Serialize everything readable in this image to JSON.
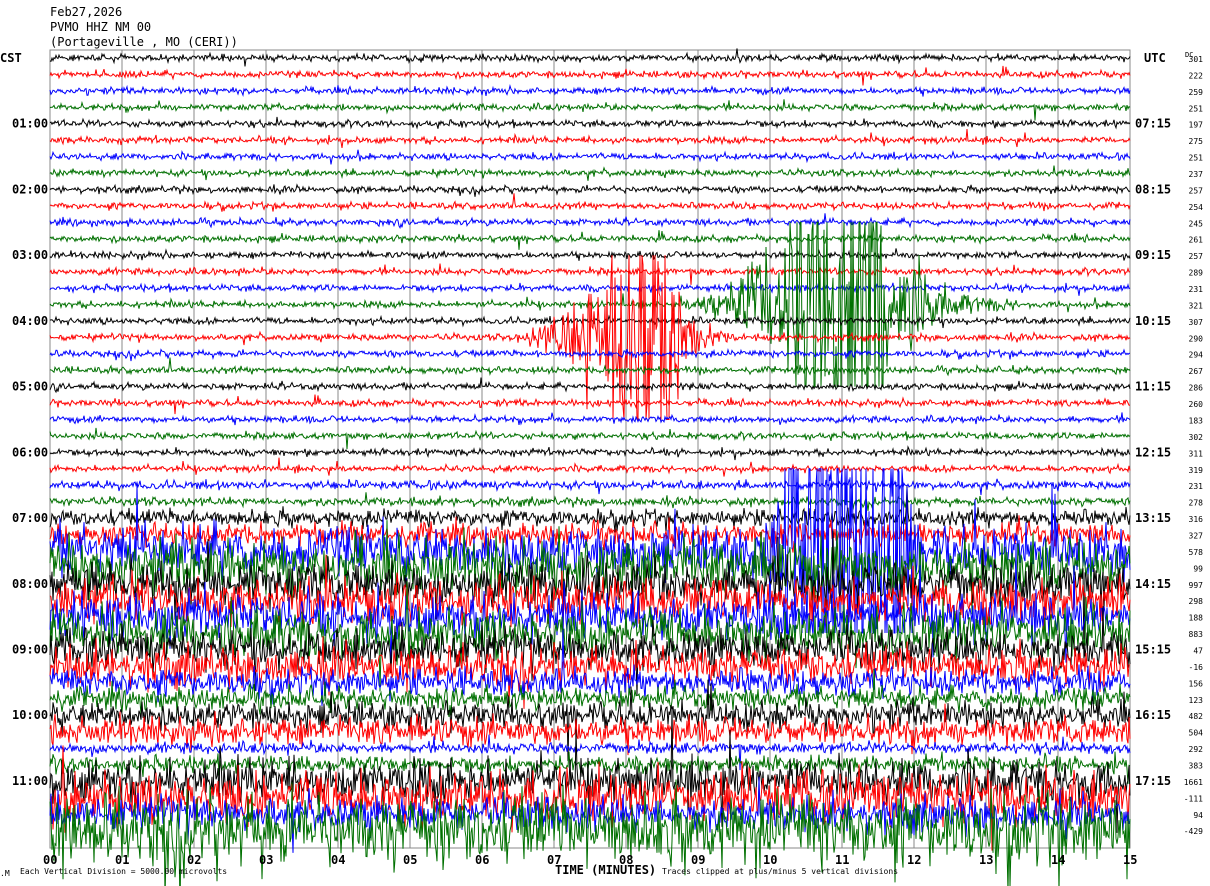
{
  "header": {
    "date": "Feb27,2026",
    "station": "PVMO HHZ NM 00",
    "location": "(Portageville , MO (CERI))",
    "left_tz": "CST",
    "right_tz": "UTC",
    "dc_label": "DC"
  },
  "footer": {
    "scale_note": "Each Vertical Division = 5000.00 microvolts",
    "xlabel": "TIME (MINUTES)",
    "clip_note": "Traces clipped at plus/minus 5 vertical divisions"
  },
  "colors": {
    "cycle": [
      "#000000",
      "#ff0000",
      "#0000ff",
      "#007000"
    ],
    "grid": "#888888"
  },
  "chart_data": {
    "type": "line",
    "title": "PVMO HHZ NM 00 helicorder",
    "xlabel": "TIME (MINUTES)",
    "xlim": [
      0,
      15
    ],
    "x_ticks": [
      "00",
      "01",
      "02",
      "03",
      "04",
      "05",
      "06",
      "07",
      "08",
      "09",
      "10",
      "11",
      "12",
      "13",
      "14",
      "15"
    ],
    "trace_count": 48,
    "minutes_per_trace": 15,
    "clip_divisions": 5,
    "cst_labels": [
      "01:00",
      "02:00",
      "03:00",
      "04:00",
      "05:00",
      "06:00",
      "07:00",
      "08:00",
      "09:00",
      "10:00",
      "11:00"
    ],
    "utc_labels": [
      "07:15",
      "08:15",
      "09:15",
      "10:15",
      "11:15",
      "12:15",
      "13:15",
      "14:15",
      "15:15",
      "16:15",
      "17:15"
    ],
    "dc_offsets": [
      "301",
      "222",
      "259",
      "251",
      "197",
      "275",
      "251",
      "237",
      "257",
      "254",
      "245",
      "261",
      "257",
      "289",
      "231",
      "321",
      "307",
      "290",
      "294",
      "267",
      "286",
      "260",
      "183",
      "302",
      "311",
      "319",
      "231",
      "278",
      "316",
      "327",
      "578",
      "99",
      "997",
      "298",
      "188",
      "883",
      "47",
      "-16",
      "156",
      "123",
      "482",
      "504",
      "292",
      "383",
      "1661",
      "-111",
      "94",
      "-429"
    ],
    "noise_level_divisions": [
      0.12,
      0.12,
      0.12,
      0.12,
      0.12,
      0.12,
      0.12,
      0.12,
      0.12,
      0.12,
      0.12,
      0.12,
      0.12,
      0.12,
      0.12,
      0.12,
      0.12,
      0.12,
      0.12,
      0.12,
      0.12,
      0.12,
      0.12,
      0.12,
      0.12,
      0.12,
      0.15,
      0.15,
      0.3,
      0.4,
      0.9,
      1.0,
      0.8,
      0.8,
      0.8,
      0.9,
      0.7,
      0.7,
      0.5,
      0.4,
      0.5,
      0.5,
      0.2,
      0.3,
      0.8,
      0.9,
      0.6,
      1.3
    ],
    "events": [
      {
        "trace": 17,
        "start_min": 6.3,
        "peak_start": 7.8,
        "peak_end": 8.6,
        "end_min": 9.5,
        "peak_divisions": 5
      },
      {
        "trace": 15,
        "start_min": 8.5,
        "peak_start": 10.3,
        "peak_end": 11.6,
        "end_min": 13.5,
        "peak_divisions": 5
      },
      {
        "trace": 30,
        "start_min": 9.8,
        "peak_start": 10.2,
        "peak_end": 11.8,
        "end_min": 12.3,
        "peak_divisions": 5
      }
    ]
  }
}
